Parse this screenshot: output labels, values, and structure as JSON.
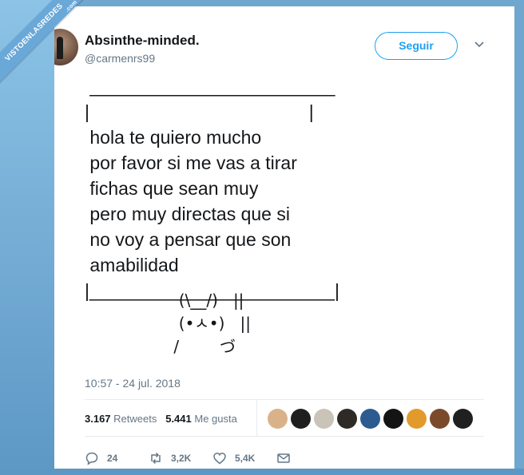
{
  "watermark": {
    "text": "VISTOENLASREDES",
    "suffix": ".com"
  },
  "user": {
    "name": "Absinthe-minded.",
    "handle": "@carmenrs99",
    "follow_label": "Seguir"
  },
  "tweet": {
    "text": " ________________________\n|                                           |\n hola te quiero mucho\n por favor si me vas a tirar\n fichas que sean muy\n pero muy directas que si\n no voy a pensar que son\n amabilidad\n|________________________|",
    "art": "     (\\__/)   ||\n     (•ㅅ•)   ||\n    /        づ",
    "timestamp": "10:57 - 24 jul. 2018"
  },
  "stats": {
    "retweets_count": "3.167",
    "retweets_label": "Retweets",
    "likes_count": "5.441",
    "likes_label": "Me gusta"
  },
  "liker_avatars": [
    {
      "icon": "liker-avatar-1",
      "color": "#d9b28a"
    },
    {
      "icon": "liker-avatar-2",
      "color": "#1f1f1f"
    },
    {
      "icon": "liker-avatar-3",
      "color": "#c9c3b8"
    },
    {
      "icon": "liker-avatar-4",
      "color": "#2e2a26"
    },
    {
      "icon": "liker-avatar-5",
      "color": "#2c5b8f"
    },
    {
      "icon": "liker-avatar-6",
      "color": "#141414"
    },
    {
      "icon": "liker-avatar-7",
      "color": "#e39a2c"
    },
    {
      "icon": "liker-avatar-8",
      "color": "#7a4a2b"
    },
    {
      "icon": "liker-avatar-9",
      "color": "#202020"
    }
  ],
  "actions": {
    "reply_count": "24",
    "retweet_count": "3,2K",
    "like_count": "5,4K"
  },
  "colors": {
    "accent": "#1da1f2",
    "text": "#14171a",
    "muted": "#657786",
    "background": "#6fa7cf"
  }
}
